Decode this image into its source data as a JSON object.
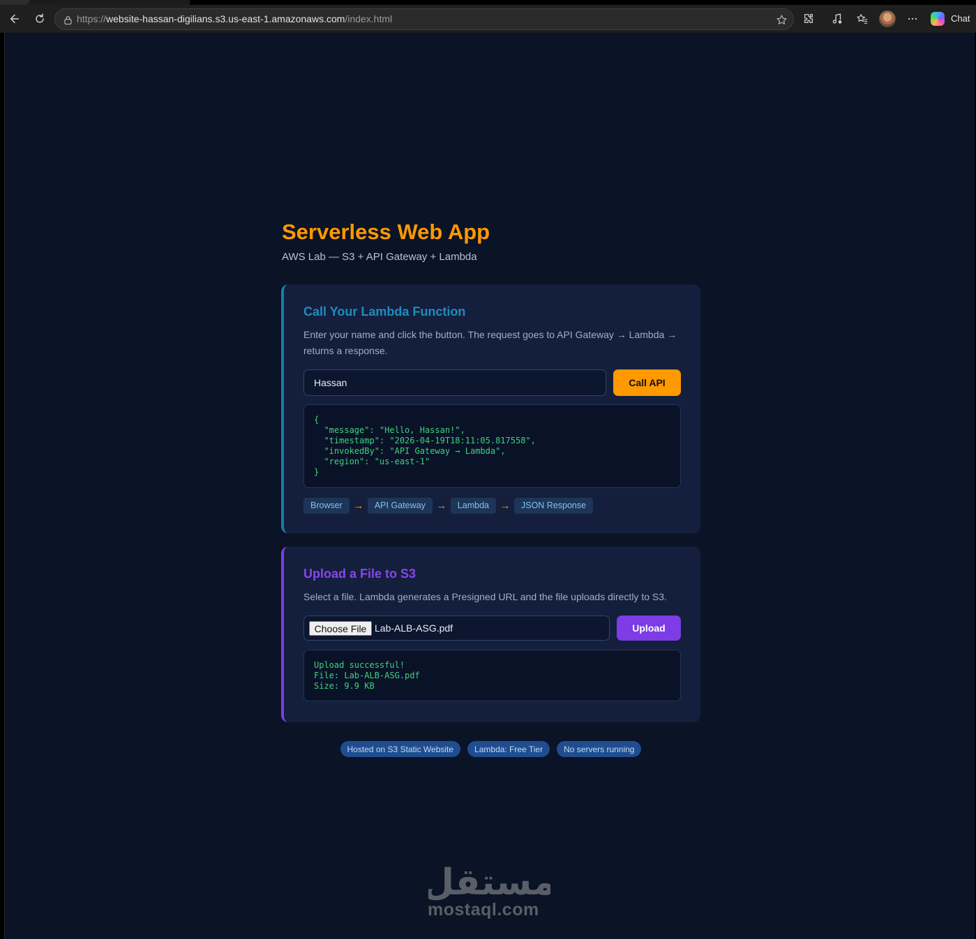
{
  "browser": {
    "url_prefix": "https://",
    "url_host": "website-hassan-digilians.s3.us-east-1.amazonaws.com",
    "url_path": "/index.html",
    "chat_label": "Chat"
  },
  "page": {
    "title": "Serverless Web App",
    "subtitle": "AWS Lab — S3 + API Gateway + Lambda"
  },
  "lambda_card": {
    "title": "Call Your Lambda Function",
    "description": "Enter your name and click the button. The request goes to API Gateway → Lambda → returns a response.",
    "name_value": "Hassan",
    "button_label": "Call API",
    "response": "{\n  \"message\": \"Hello, Hassan!\",\n  \"timestamp\": \"2026-04-19T18:11:05.817558\",\n  \"invokedBy\": \"API Gateway → Lambda\",\n  \"region\": \"us-east-1\"\n}",
    "flow": [
      "Browser",
      "API Gateway",
      "Lambda",
      "JSON Response"
    ],
    "flow_arrow": "→"
  },
  "upload_card": {
    "title": "Upload a File to S3",
    "description": "Select a file. Lambda generates a Presigned URL and the file uploads directly to S3.",
    "choose_label": "Choose File",
    "file_name": "Lab-ALB-ASG.pdf",
    "button_label": "Upload",
    "result": "Upload successful!\nFile: Lab-ALB-ASG.pdf\nSize: 9.9 KB"
  },
  "footer_badges": [
    "Hosted on S3 Static Website",
    "Lambda: Free Tier",
    "No servers running"
  ],
  "watermark": {
    "arabic": "مستقل",
    "latin": "mostaql.com"
  },
  "colors": {
    "page_bg": "#0b1326",
    "card_bg": "#131f3c",
    "accent_orange": "#ff9900",
    "accent_blue": "#1f8cbf",
    "accent_purple": "#7d3ce6",
    "code_green": "#3fd37a"
  },
  "icons": [
    "back-icon",
    "reload-icon",
    "site-info-icon",
    "favorite-star-icon",
    "extensions-icon",
    "media-icon",
    "favorites-icon",
    "more-icon",
    "copilot-icon"
  ]
}
